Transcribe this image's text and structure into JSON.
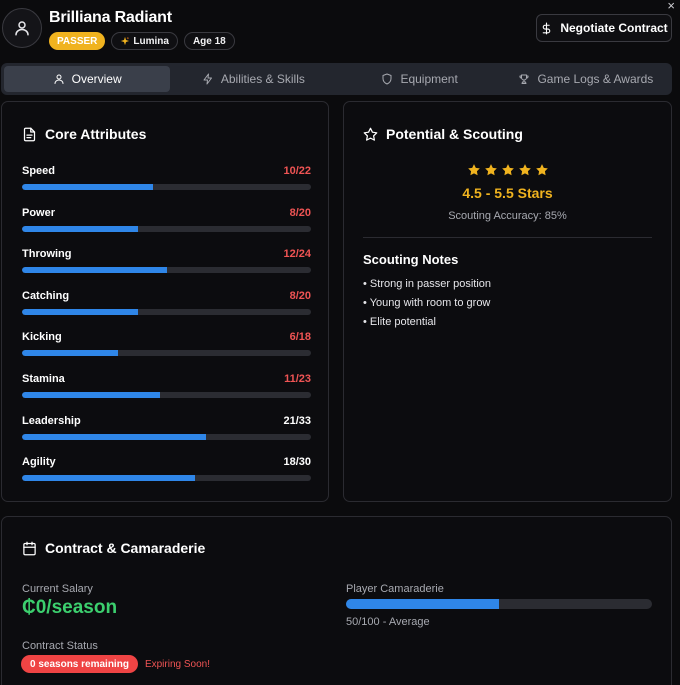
{
  "window": {
    "close_glyph": "×"
  },
  "player": {
    "name": "Brilliana Radiant",
    "position": "PASSER",
    "trait_icon": "sparkle-icon",
    "trait": "Lumina",
    "age": "Age 18"
  },
  "header": {
    "negotiate_label": "Negotiate Contract",
    "negotiate_icon": "dollar-icon"
  },
  "tabs": [
    {
      "label": "Overview",
      "icon": "user-icon",
      "active": true
    },
    {
      "label": "Abilities & Skills",
      "icon": "lightning-icon",
      "active": false
    },
    {
      "label": "Equipment",
      "icon": "shield-icon",
      "active": false
    },
    {
      "label": "Game Logs & Awards",
      "icon": "trophy-icon",
      "active": false
    }
  ],
  "core": {
    "title": "Core Attributes",
    "attributes": [
      {
        "name": "Speed",
        "value": "10/22",
        "current": 10,
        "max": 22,
        "low": true
      },
      {
        "name": "Power",
        "value": "8/20",
        "current": 8,
        "max": 20,
        "low": true
      },
      {
        "name": "Throwing",
        "value": "12/24",
        "current": 12,
        "max": 24,
        "low": true
      },
      {
        "name": "Catching",
        "value": "8/20",
        "current": 8,
        "max": 20,
        "low": true
      },
      {
        "name": "Kicking",
        "value": "6/18",
        "current": 6,
        "max": 18,
        "low": true
      },
      {
        "name": "Stamina",
        "value": "11/23",
        "current": 11,
        "max": 23,
        "low": true
      },
      {
        "name": "Leadership",
        "value": "21/33",
        "current": 21,
        "max": 33,
        "low": false
      },
      {
        "name": "Agility",
        "value": "18/30",
        "current": 18,
        "max": 30,
        "low": false
      }
    ]
  },
  "scouting": {
    "title": "Potential & Scouting",
    "star_count": 5,
    "rating": "4.5 - 5.5 Stars",
    "accuracy": "Scouting Accuracy: 85%",
    "notes_title": "Scouting Notes",
    "notes": [
      "Strong in passer position",
      "Young with room to grow",
      "Elite potential"
    ]
  },
  "contract": {
    "title": "Contract & Camaraderie",
    "salary_label": "Current Salary",
    "salary": "₵0/season",
    "status_label": "Contract Status",
    "seasons_remaining": "0 seasons remaining",
    "expiring": "Expiring Soon!",
    "camaraderie_label": "Player Camaraderie",
    "camaraderie_value": 50,
    "camaraderie_max": 100,
    "camaraderie_text": "50/100 - Average"
  },
  "colors": {
    "accent": "#2f86e8",
    "gold": "#f0b31f",
    "danger": "#ef5454",
    "success": "#3ccf6e"
  }
}
